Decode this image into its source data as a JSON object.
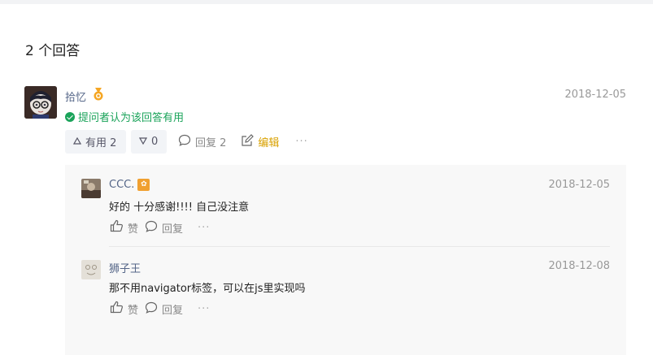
{
  "answers_title": "2 个回答",
  "answer": {
    "author": "拾忆",
    "date": "2018-12-05",
    "accepted_text": "提问者认为该回答有用",
    "upvote_label": "有用 2",
    "downvote_label": "0",
    "reply_label": "回复 2",
    "edit_label": "编辑",
    "more_label": "···"
  },
  "comments": [
    {
      "author": "CCC.",
      "badge": "✿",
      "date": "2018-12-05",
      "body": "好的 十分感谢!!!! 自己没注意",
      "like_label": "赞",
      "reply_label": "回复",
      "more_label": "···"
    },
    {
      "author": "狮子王",
      "date": "2018-12-08",
      "body": "那不用navigator标签，可以在js里实现吗",
      "like_label": "赞",
      "reply_label": "回复",
      "more_label": "···"
    }
  ]
}
